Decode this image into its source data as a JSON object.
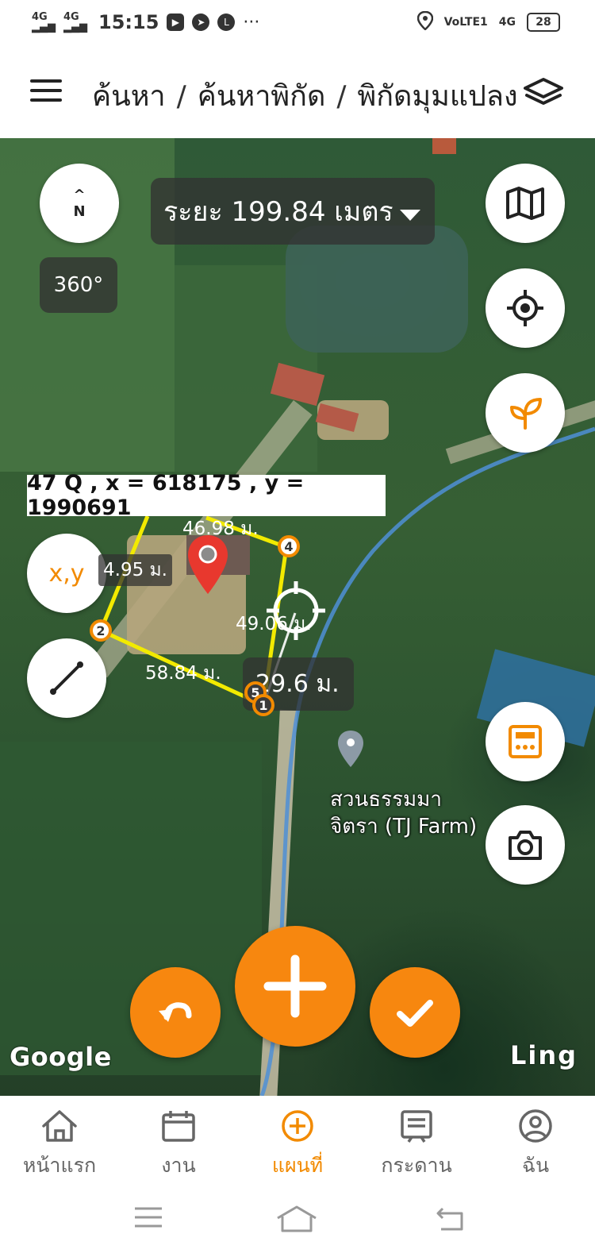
{
  "status_bar": {
    "network1": "4G",
    "network2": "4G",
    "time": "15:15",
    "more": "···",
    "volte": "VoLTE1",
    "network3": "4G",
    "battery": "28"
  },
  "header": {
    "crumbs": [
      "ค้นหา",
      "ค้นหาพิกัด",
      "พิกัดมุมแปลง"
    ],
    "separator": "/"
  },
  "map": {
    "compass_letter": "N",
    "view_360_label": "360°",
    "distance_label": "ระยะ 199.84 เมตร",
    "coord_label": "47 Q , x = 618175 , y = 1990691",
    "xy_button_label": "x,y",
    "segments": [
      {
        "label": "46.98 ม."
      },
      {
        "label": "4.95 ม."
      },
      {
        "label": "49.06 ม."
      },
      {
        "label": "58.84 ม."
      },
      {
        "label": "29.6 ม."
      }
    ],
    "vertices": [
      {
        "label": "1"
      },
      {
        "label": "2"
      },
      {
        "label": "4"
      },
      {
        "label": "5"
      }
    ],
    "poi": {
      "line1": "สวนธรรมมา",
      "line2": "จิตรา (TJ Farm)"
    },
    "google_logo": "Google",
    "ling_logo": "Ling"
  },
  "bottom_nav": {
    "items": [
      {
        "label": "หน้าแรก",
        "icon": "home-icon"
      },
      {
        "label": "งาน",
        "icon": "calendar-icon"
      },
      {
        "label": "แผนที่",
        "icon": "add-circle-icon"
      },
      {
        "label": "กระดาน",
        "icon": "board-icon"
      },
      {
        "label": "ฉัน",
        "icon": "profile-icon"
      }
    ],
    "active_index": 2
  },
  "colors": {
    "accent": "#f28a00",
    "overlay": "#323232",
    "polygon": "#f2ea00"
  }
}
